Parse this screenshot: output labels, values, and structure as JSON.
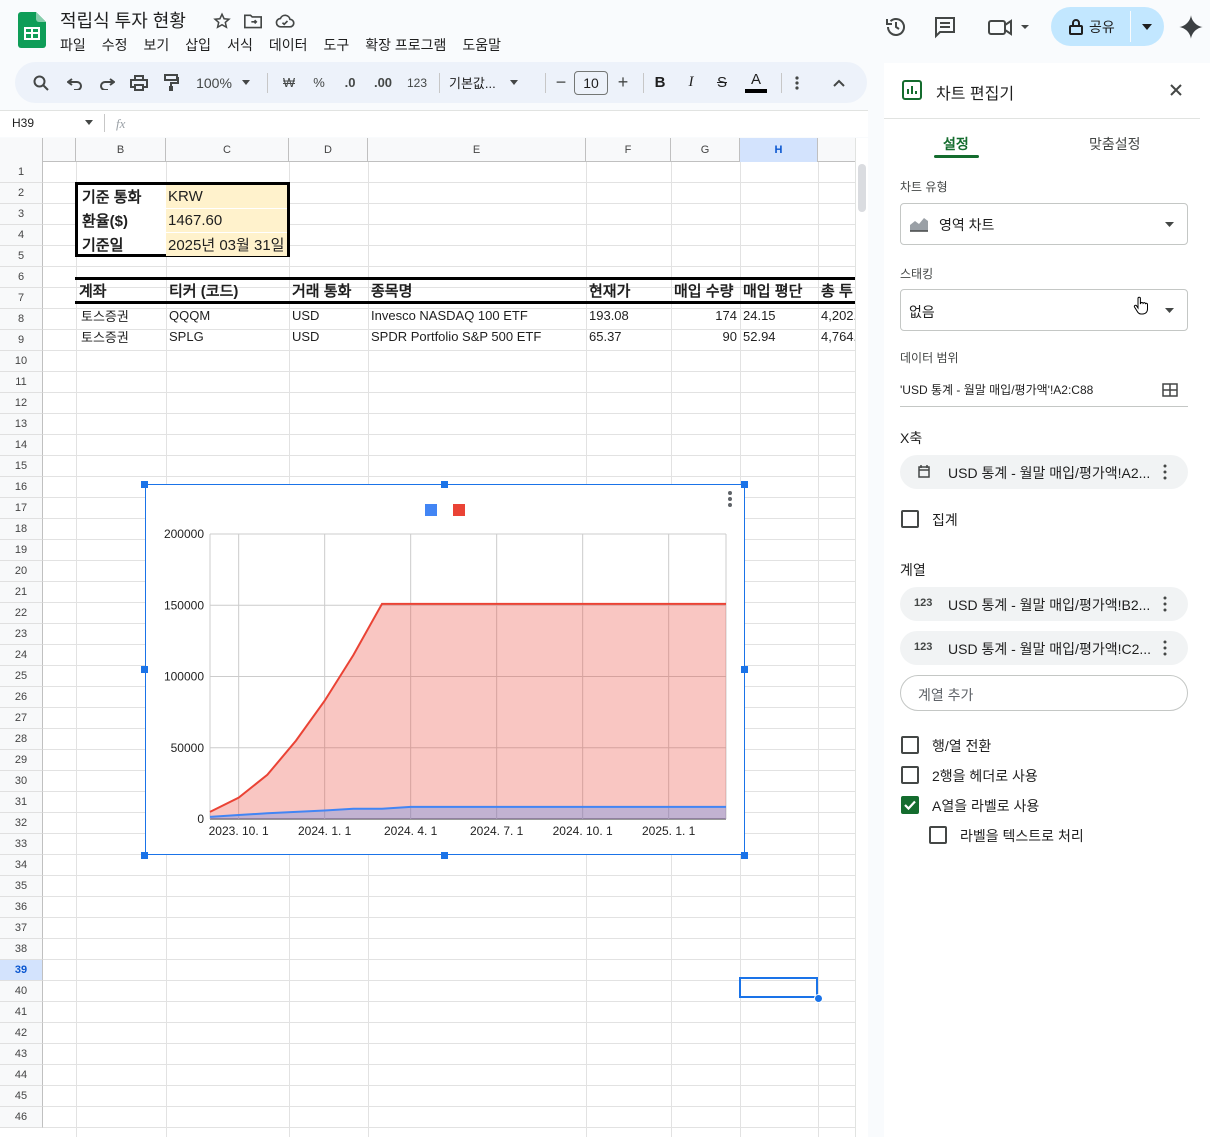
{
  "app": {
    "title": "적립식 투자 현황",
    "menu": [
      "파일",
      "수정",
      "보기",
      "삽입",
      "서식",
      "데이터",
      "도구",
      "확장 프로그램",
      "도움말"
    ],
    "share_label": "공유"
  },
  "toolbar": {
    "zoom": "100%",
    "currency": "₩",
    "percent": "%",
    "dec_decrease": ".0",
    "dec_increase": ".00",
    "number_format": "123",
    "font": "기본값...",
    "font_size": "10",
    "minus": "−",
    "plus": "+",
    "bold": "B",
    "italic": "I",
    "strike": "S",
    "text_color": "A"
  },
  "formula_bar": {
    "cell": "H39",
    "fx": "fx",
    "value": ""
  },
  "sheet": {
    "columns": [
      "B",
      "C",
      "D",
      "E",
      "F",
      "G",
      "H"
    ],
    "selected_column": "H",
    "selected_row": 39,
    "info": [
      {
        "key": "기준 통화",
        "value": "KRW"
      },
      {
        "key": "환율($)",
        "value": "1467.60"
      },
      {
        "key": "기준일",
        "value": "2025년 03월 31일"
      }
    ],
    "table_headers": [
      "계좌",
      "티커 (코드)",
      "거래 통화",
      "종목명",
      "현재가",
      "매입 수량",
      "매입 평단",
      "총 투"
    ],
    "rows": [
      [
        "토스증권",
        "QQQM",
        "USD",
        "Invesco NASDAQ 100 ETF",
        "193.08",
        "174",
        "24.15",
        "4,202."
      ],
      [
        "토스증권",
        "SPLG",
        "USD",
        "SPDR Portfolio S&P 500 ETF",
        "65.37",
        "90",
        "52.94",
        "4,764."
      ]
    ]
  },
  "chart_data": {
    "type": "area",
    "title": "",
    "xlabel": "",
    "ylabel": "",
    "ylim": [
      0,
      200000
    ],
    "yticks": [
      "200000",
      "150000",
      "100000",
      "50000",
      "0"
    ],
    "xticks": [
      "2023. 10. 1",
      "2024. 1. 1",
      "2024. 4. 1",
      "2024. 7. 1",
      "2024. 10. 1",
      "2025. 1. 1"
    ],
    "x": [
      "2023-09",
      "2023-10",
      "2023-11",
      "2023-12",
      "2024-01",
      "2024-02",
      "2024-03",
      "2024-04",
      "2024-05",
      "2024-06",
      "2024-07",
      "2024-08",
      "2024-09",
      "2024-10",
      "2024-11",
      "2024-12",
      "2025-01",
      "2025-02",
      "2025-03"
    ],
    "series": [
      {
        "color": "#4285f4",
        "values": [
          1500,
          2800,
          4000,
          5000,
          6000,
          7200,
          7200,
          8500,
          8500,
          8500,
          8500,
          8500,
          8500,
          8500,
          8500,
          8500,
          8500,
          8500,
          8500
        ]
      },
      {
        "color": "#ea4335",
        "values": [
          5000,
          15000,
          31000,
          55000,
          83000,
          115000,
          151000,
          151000,
          151000,
          151000,
          151000,
          151000,
          151000,
          151000,
          151000,
          151000,
          151000,
          151000,
          151000
        ]
      }
    ],
    "legend": "top",
    "grid": true
  },
  "panel": {
    "title": "차트 편집기",
    "tabs": [
      "설정",
      "맞춤설정"
    ],
    "chart_type_label": "차트 유형",
    "chart_type_value": "영역 차트",
    "stacking_label": "스태킹",
    "stacking_value": "없음",
    "range_label": "데이터 범위",
    "range_value": "'USD 통계 - 월말 매입/평가액'!A2:C88",
    "x_axis_label": "X축",
    "x_axis_value": "USD 통계 - 월말 매입/평가액!A2...",
    "aggregate_label": "집계",
    "series_label": "계열",
    "series": [
      {
        "icon": "123",
        "value": "USD 통계 - 월말 매입/평가액!B2..."
      },
      {
        "icon": "123",
        "value": "USD 통계 - 월말 매입/평가액!C2..."
      }
    ],
    "add_series": "계열 추가",
    "options": [
      {
        "label": "행/열 전환",
        "checked": false
      },
      {
        "label": "2행을 헤더로 사용",
        "checked": false
      },
      {
        "label": "A열을 라벨로 사용",
        "checked": true
      },
      {
        "label": "라벨을 텍스트로 처리",
        "checked": false
      }
    ]
  }
}
